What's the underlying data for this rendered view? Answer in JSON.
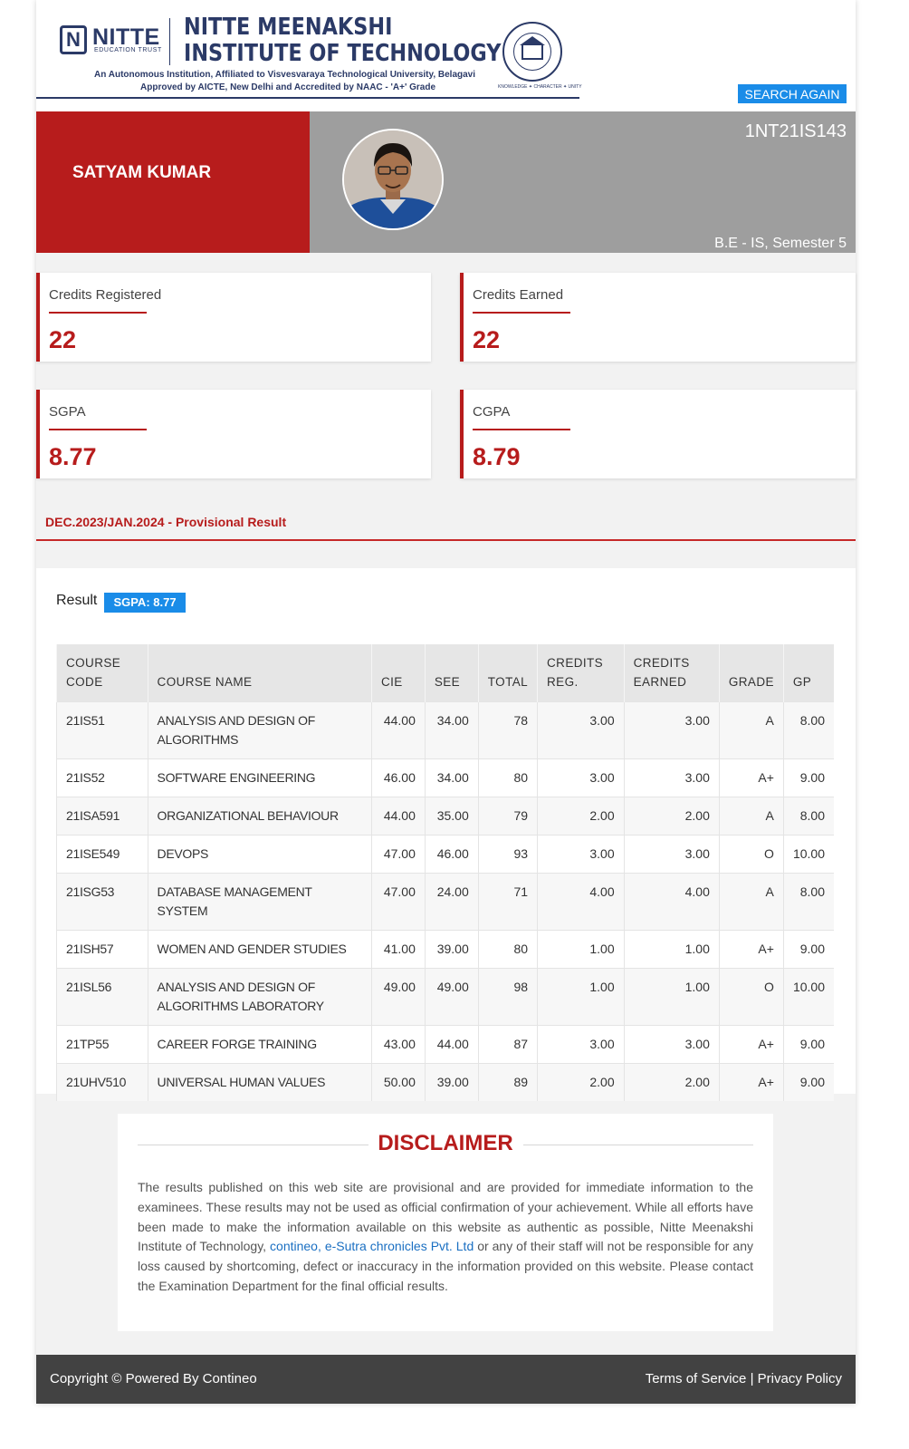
{
  "header": {
    "logo_letter": "N",
    "logo_text": "NITTE",
    "logo_sub": "EDUCATION TRUST",
    "institute_line1": "NITTE MEENAKSHI",
    "institute_line2": "INSTITUTE OF TECHNOLOGY",
    "affiliation": "An Autonomous Institution, Affiliated to Visvesvaraya Technological University, Belagavi",
    "approval": "Approved by AICTE, New Delhi and Accredited by NAAC - 'A+' Grade",
    "seal_motto": "KNOWLEDGE ✦ CHARACTER ✦ UNITY",
    "search_again_label": "SEARCH AGAIN"
  },
  "student": {
    "name": "SATYAM KUMAR",
    "usn": "1NT21IS143",
    "program": "B.E - IS, Semester 5"
  },
  "stats": [
    {
      "label": "Credits Registered",
      "value": "22"
    },
    {
      "label": "Credits Earned",
      "value": "22"
    },
    {
      "label": "SGPA",
      "value": "8.77"
    },
    {
      "label": "CGPA",
      "value": "8.79"
    }
  ],
  "exam": {
    "title": "DEC.2023/JAN.2024 - Provisional Result",
    "result_label": "Result",
    "sgpa_badge": "SGPA: 8.77"
  },
  "table": {
    "headers": {
      "code_1": "COURSE",
      "code_2": "CODE",
      "name": "COURSE NAME",
      "cie": "CIE",
      "see": "SEE",
      "total": "TOTAL",
      "creg_1": "CREDITS",
      "creg_2": "REG.",
      "cearn_1": "CREDITS",
      "cearn_2": "EARNED",
      "grade": "GRADE",
      "gp": "GP"
    },
    "rows": [
      {
        "code": "21IS51",
        "name": "ANALYSIS AND DESIGN OF ALGORITHMS",
        "cie": "44.00",
        "see": "34.00",
        "total": "78",
        "creg": "3.00",
        "cearn": "3.00",
        "grade": "A",
        "gp": "8.00"
      },
      {
        "code": "21IS52",
        "name": "SOFTWARE ENGINEERING",
        "cie": "46.00",
        "see": "34.00",
        "total": "80",
        "creg": "3.00",
        "cearn": "3.00",
        "grade": "A+",
        "gp": "9.00"
      },
      {
        "code": "21ISA591",
        "name": "ORGANIZATIONAL BEHAVIOUR",
        "cie": "44.00",
        "see": "35.00",
        "total": "79",
        "creg": "2.00",
        "cearn": "2.00",
        "grade": "A",
        "gp": "8.00"
      },
      {
        "code": "21ISE549",
        "name": "DEVOPS",
        "cie": "47.00",
        "see": "46.00",
        "total": "93",
        "creg": "3.00",
        "cearn": "3.00",
        "grade": "O",
        "gp": "10.00"
      },
      {
        "code": "21ISG53",
        "name": "DATABASE MANAGEMENT SYSTEM",
        "cie": "47.00",
        "see": "24.00",
        "total": "71",
        "creg": "4.00",
        "cearn": "4.00",
        "grade": "A",
        "gp": "8.00"
      },
      {
        "code": "21ISH57",
        "name": "WOMEN AND GENDER STUDIES",
        "cie": "41.00",
        "see": "39.00",
        "total": "80",
        "creg": "1.00",
        "cearn": "1.00",
        "grade": "A+",
        "gp": "9.00"
      },
      {
        "code": "21ISL56",
        "name": "ANALYSIS AND DESIGN OF ALGORITHMS LABORATORY",
        "cie": "49.00",
        "see": "49.00",
        "total": "98",
        "creg": "1.00",
        "cearn": "1.00",
        "grade": "O",
        "gp": "10.00"
      },
      {
        "code": "21TP55",
        "name": "CAREER FORGE TRAINING",
        "cie": "43.00",
        "see": "44.00",
        "total": "87",
        "creg": "3.00",
        "cearn": "3.00",
        "grade": "A+",
        "gp": "9.00"
      },
      {
        "code": "21UHV510",
        "name": "UNIVERSAL HUMAN VALUES",
        "cie": "50.00",
        "see": "39.00",
        "total": "89",
        "creg": "2.00",
        "cearn": "2.00",
        "grade": "A+",
        "gp": "9.00"
      }
    ]
  },
  "disclaimer": {
    "title": "DISCLAIMER",
    "text_before": "The results published on this web site are provisional and are provided for immediate information to the examinees. These results may not be used as official confirmation of your achievement. While all efforts have been made to make the information available on this website as authentic as possible, Nitte Meenakshi Institute of Technology, ",
    "link_text": "contineo, e-Sutra chronicles Pvt. Ltd",
    "text_after": " or any of their staff will not be responsible for any loss caused by shortcoming, defect or inaccuracy in the information provided on this website. Please contact the Examination Department for the final official results."
  },
  "footer": {
    "copyright": "Copyright © Powered By Contineo",
    "terms": "Terms of Service",
    "separator": "|",
    "privacy": "Privacy Policy"
  },
  "colors": {
    "brand_red": "#b71c1c",
    "brand_navy": "#2b3a67",
    "accent_blue": "#1a8ce8",
    "banner_grey": "#9e9e9e",
    "footer_dark": "#424242"
  }
}
